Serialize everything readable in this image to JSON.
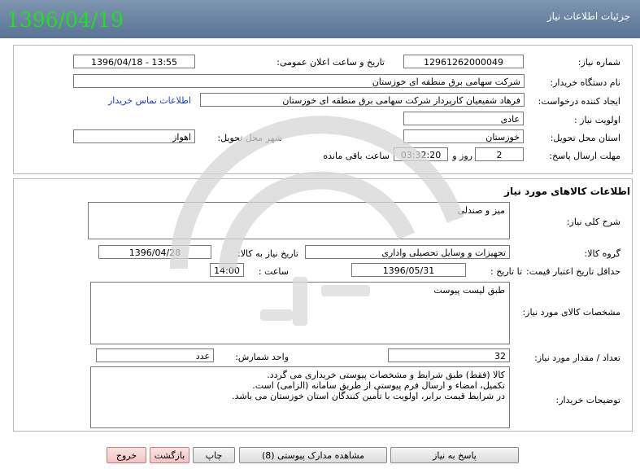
{
  "header": {
    "title": "جزئیات اطلاعات نیاز",
    "date_stamp": "1396/04/19"
  },
  "need_info": {
    "need_number_label": "شماره نیاز:",
    "need_number": "12961262000049",
    "announce_label": "تاریخ و ساعت اعلان عمومی:",
    "announce_value": "1396/04/18 - 13:55",
    "buyer_org_label": "نام دستگاه خریدار:",
    "buyer_org": "شرکت سهامی برق منطقه ای خوزستان",
    "creator_label": "ایجاد کننده درخواست:",
    "creator": "فرهاد شفیعیان کارپرداز شرکت سهامی برق منطقه ای خوزستان",
    "contact_link": "اطلاعات تماس خریدار",
    "priority_label": "اولویت نیاز :",
    "priority": "عادی",
    "province_label": "استان محل تحویل:",
    "province": "خوزستان",
    "city_label": "شهر محل تحویل:",
    "city": "اهواز",
    "deadline_label": "مهلت ارسال پاسخ:",
    "deadline_days": "2",
    "days_word": "روز و",
    "deadline_time": "03:32:20",
    "remaining_word": "ساعت باقی مانده"
  },
  "goods": {
    "section_title": "اطلاعات کالاهای مورد نیاز",
    "summary_label": "شرح کلی نیاز:",
    "summary": "میز و صندلی",
    "group_label": "گروه کالا:",
    "group": "تجهیزات و وسایل تحصیلی واداری",
    "need_date_label": "تاریخ نیاز به کالا:",
    "need_date": "1396/04/28",
    "price_validity_label": "حداقل تاریخ اعتبار قیمت:",
    "until_date_label": "تا تاریخ :",
    "until_date": "1396/05/31",
    "time_label": "ساعت :",
    "time": "14:00",
    "specs_label": "مشخصات کالای مورد نیاز:",
    "specs": "طبق لیست پیوست",
    "quantity_label": "تعداد / مقدار مورد نیاز:",
    "quantity": "32",
    "unit_label": "واحد شمارش:",
    "unit": "عدد",
    "buyer_notes_label": "توضیحات خریدار:",
    "buyer_notes": [
      "کالا (فقط) طبق شرایط و مشخصات پیوستی خریداری می گردد.",
      "تکمیل، امضاء و ارسال فرم پیوستی از طریق سامانه (الزامی) است.",
      "در شرایط قیمت برابر، اولویت با تأمین کنندگان استان خوزستان می باشد."
    ]
  },
  "buttons": {
    "reply": "پاسخ به نیاز",
    "attachments": "مشاهده مدارک پیوستی (8)",
    "print": "چاپ",
    "back": "بازگشت",
    "exit": "خروج"
  },
  "watermark_icon": "ariatender-logo-watermark"
}
